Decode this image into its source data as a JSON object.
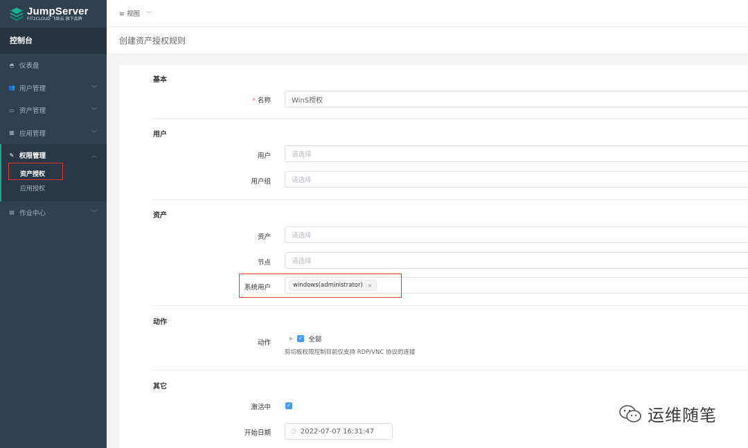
{
  "brand": {
    "title": "JumpServer",
    "subtitle": "FIT2CLOUD 飞致云  旗下品牌"
  },
  "sidebar": {
    "console": "控制台",
    "items": [
      {
        "label": "仪表盘",
        "icon": "dashboard-icon"
      },
      {
        "label": "用户管理",
        "icon": "users-icon"
      },
      {
        "label": "资产管理",
        "icon": "laptop-icon"
      },
      {
        "label": "应用管理",
        "icon": "grid-icon"
      },
      {
        "label": "权限管理",
        "icon": "edit-icon"
      },
      {
        "label": "作业中心",
        "icon": "terminal-icon"
      }
    ],
    "sub_items": [
      {
        "label": "资产授权"
      },
      {
        "label": "应用授权"
      }
    ]
  },
  "topbar": {
    "view_label": "视图"
  },
  "page": {
    "title": "创建资产授权规则"
  },
  "form": {
    "sections": {
      "basic": "基本",
      "users": "用户",
      "assets": "资产",
      "actions": "动作",
      "other": "其它"
    },
    "name": {
      "label": "名称",
      "required_mark": "*",
      "value": "WinS授权"
    },
    "user": {
      "label": "用户",
      "placeholder": "请选择"
    },
    "user_group": {
      "label": "用户组",
      "placeholder": "请选择"
    },
    "asset": {
      "label": "资产",
      "placeholder": "请选择"
    },
    "node": {
      "label": "节点",
      "placeholder": "请选择"
    },
    "system_user": {
      "label": "系统用户",
      "tag": "windows(administrator)",
      "tag_close": "×"
    },
    "action": {
      "label": "动作",
      "all_label": "全部",
      "all_checked": true,
      "hint": "剪切板权限控制目前仅支持 RDP/VNC 协议的连接"
    },
    "active": {
      "label": "激活中",
      "checked": true
    },
    "start_date": {
      "label": "开始日期",
      "value": "2022-07-07 16:31:47"
    }
  },
  "watermark": {
    "text": "运维随笔"
  },
  "colors": {
    "sidebar_bg": "#2f4050",
    "accent_green": "#19aa8d",
    "checkbox_blue": "#409eff",
    "highlight_red": "#e8382d"
  }
}
